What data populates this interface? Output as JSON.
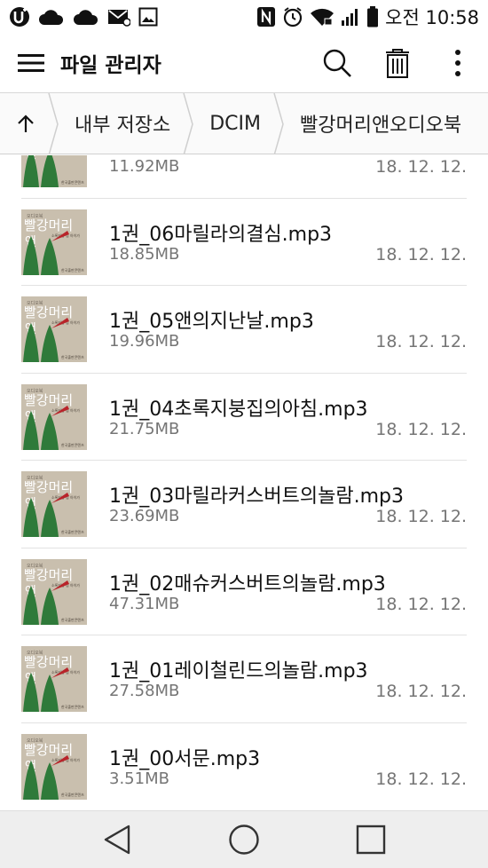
{
  "status_bar": {
    "icons_left": [
      "u-plus-icon",
      "cloud-icon",
      "cloud-icon",
      "mail-icon",
      "image-icon"
    ],
    "icons_right": [
      "nfc-icon",
      "alarm-icon",
      "wifi-icon",
      "signal-icon",
      "battery-icon"
    ],
    "time": "오전 10:58"
  },
  "app_bar": {
    "title": "파일 관리자",
    "actions": [
      "search-icon",
      "delete-icon",
      "more-icon"
    ]
  },
  "breadcrumb": {
    "items": [
      "내부 저장소",
      "DCIM",
      "빨강머리앤오디오북"
    ]
  },
  "thumbnail": {
    "line1": "오디오북",
    "title": "빨강머리",
    "title2": "앤",
    "sub": "소록지붕 집 아이가",
    "publisher": "한국출판콘텐츠"
  },
  "files": [
    {
      "name": "",
      "size": "11.92MB",
      "date": "18. 12. 12."
    },
    {
      "name": "1권_06마릴라의결심.mp3",
      "size": "18.85MB",
      "date": "18. 12. 12."
    },
    {
      "name": "1권_05앤의지난날.mp3",
      "size": "19.96MB",
      "date": "18. 12. 12."
    },
    {
      "name": "1권_04초록지붕집의아침.mp3",
      "size": "21.75MB",
      "date": "18. 12. 12."
    },
    {
      "name": "1권_03마릴라커스버트의놀람.mp3",
      "size": "23.69MB",
      "date": "18. 12. 12."
    },
    {
      "name": "1권_02매슈커스버트의놀람.mp3",
      "size": "47.31MB",
      "date": "18. 12. 12."
    },
    {
      "name": "1권_01레이철린드의놀람.mp3",
      "size": "27.58MB",
      "date": "18. 12. 12."
    },
    {
      "name": "1권_00서문.mp3",
      "size": "3.51MB",
      "date": "18. 12. 12."
    }
  ],
  "nav_bar": [
    "back-icon",
    "home-icon",
    "recents-icon"
  ],
  "colors": {
    "thumb_bg": "#c9bfae",
    "tree_green": "#2f7a3a",
    "accent_red": "#b8242a"
  }
}
